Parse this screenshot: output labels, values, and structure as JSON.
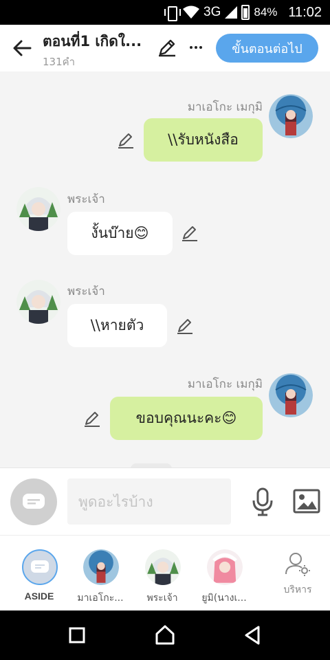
{
  "status_bar": {
    "network": "3G",
    "battery": "84%",
    "time": "11:02"
  },
  "header": {
    "title": "ตอนที่1 เกิดใ...",
    "word_count": "131คำ",
    "next_button": "ขั้นตอนต่อไป"
  },
  "messages": [
    {
      "sender": "มาเอโกะ เมกุมิ",
      "side": "right",
      "text": "\\\\รับหนังสือ",
      "avatar": "maeko-avatar"
    },
    {
      "sender": "พระเจ้า",
      "side": "left",
      "text": "งั้นบ๊าย😊",
      "avatar": "god-avatar"
    },
    {
      "sender": "พระเจ้า",
      "side": "left",
      "text": "\\\\หายตัว",
      "avatar": "god-avatar"
    },
    {
      "sender": "มาเอโกะ เมกุมิ",
      "side": "right",
      "text": "ขอบคุณนะคะ😊",
      "avatar": "maeko-avatar"
    }
  ],
  "input": {
    "placeholder": "พูดอะไรบ้าง"
  },
  "characters": [
    {
      "label": "ASIDE"
    },
    {
      "label": "มาเอโกะ..."
    },
    {
      "label": "พระเจ้า"
    },
    {
      "label": "ยูมิ(นางเ..."
    },
    {
      "label": "บริหาร"
    }
  ],
  "colors": {
    "accent": "#5aa6ec",
    "bubble_right": "#d6f0a0",
    "bubble_left": "#ffffff",
    "background": "#f4f4f4"
  }
}
